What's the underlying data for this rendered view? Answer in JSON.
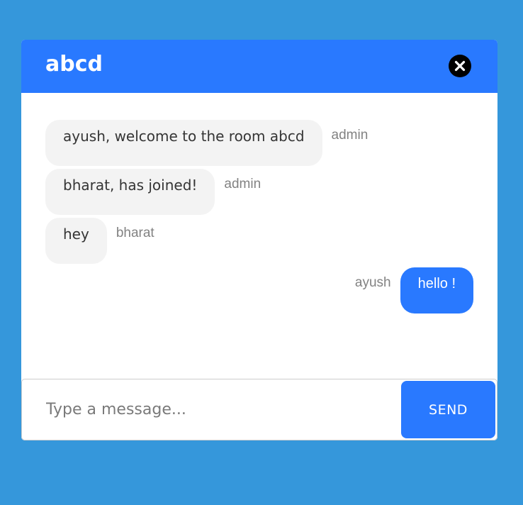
{
  "colors": {
    "page_background": "#3597db",
    "header_background": "#2979ff",
    "incoming_bubble": "#f3f3f3",
    "outgoing_bubble": "#2979ff",
    "sender_text": "#828282"
  },
  "header": {
    "room_name": "abcd",
    "close_icon": "close-circle-icon"
  },
  "messages": [
    {
      "text": "ayush, welcome to the room abcd",
      "sender": "admin",
      "direction": "incoming"
    },
    {
      "text": "bharat, has joined!",
      "sender": "admin",
      "direction": "incoming"
    },
    {
      "text": "hey",
      "sender": "bharat",
      "direction": "incoming"
    },
    {
      "text": "hello !",
      "sender": "ayush",
      "direction": "outgoing"
    }
  ],
  "composer": {
    "placeholder": "Type a message...",
    "value": "",
    "send_label": "SEND"
  }
}
